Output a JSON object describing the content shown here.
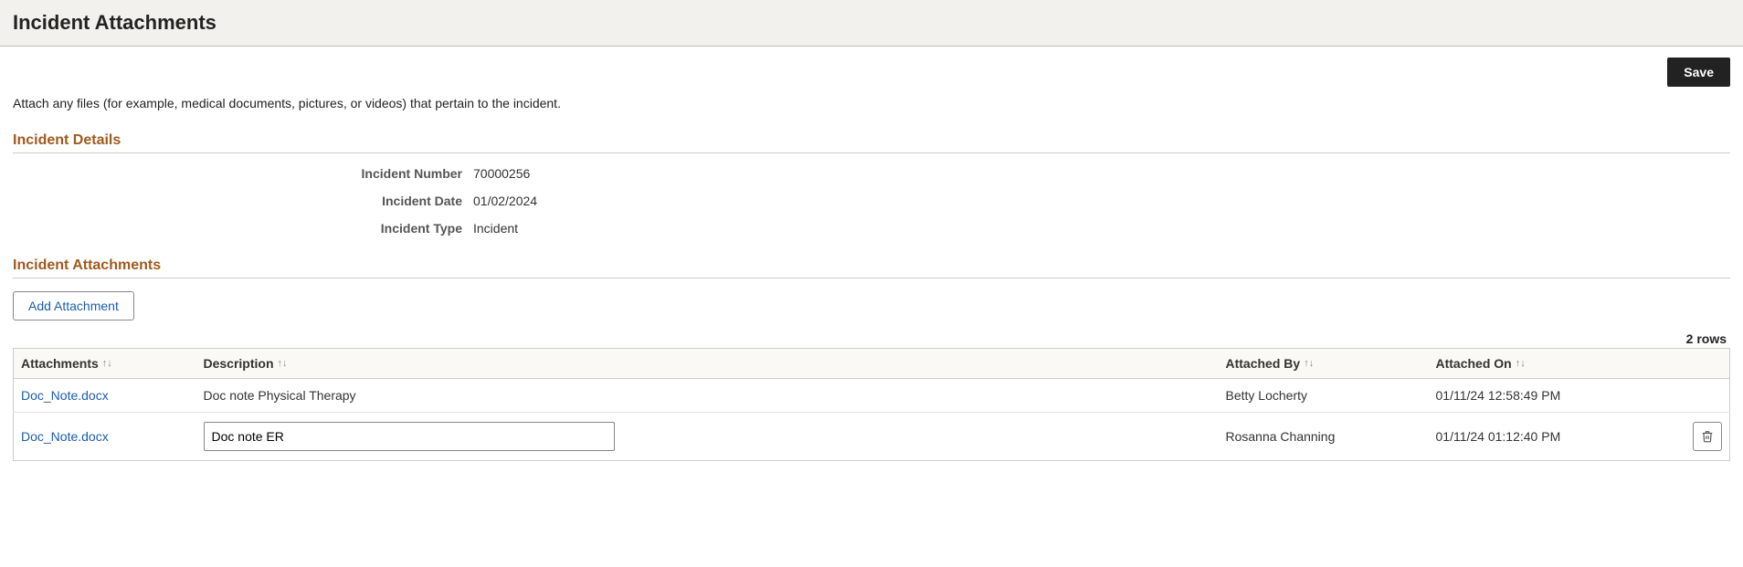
{
  "header": {
    "title": "Incident Attachments"
  },
  "actions": {
    "save_label": "Save",
    "add_attachment_label": "Add Attachment"
  },
  "instructions": "Attach any files (for example, medical documents, pictures, or videos) that pertain to the incident.",
  "sections": {
    "details_title": "Incident Details",
    "attachments_title": "Incident Attachments"
  },
  "details": {
    "incident_number_label": "Incident Number",
    "incident_number_value": "70000256",
    "incident_date_label": "Incident Date",
    "incident_date_value": "01/02/2024",
    "incident_type_label": "Incident Type",
    "incident_type_value": "Incident"
  },
  "table": {
    "row_count_text": "2 rows",
    "columns": {
      "attachments": "Attachments",
      "description": "Description",
      "attached_by": "Attached By",
      "attached_on": "Attached On"
    },
    "rows": [
      {
        "filename": "Doc_Note.docx",
        "description": "Doc note Physical Therapy",
        "attached_by": "Betty Locherty",
        "attached_on": "01/11/24 12:58:49 PM",
        "editable": false,
        "deletable": false
      },
      {
        "filename": "Doc_Note.docx",
        "description": "Doc note ER",
        "attached_by": "Rosanna Channing",
        "attached_on": "01/11/24 01:12:40 PM",
        "editable": true,
        "deletable": true
      }
    ]
  }
}
